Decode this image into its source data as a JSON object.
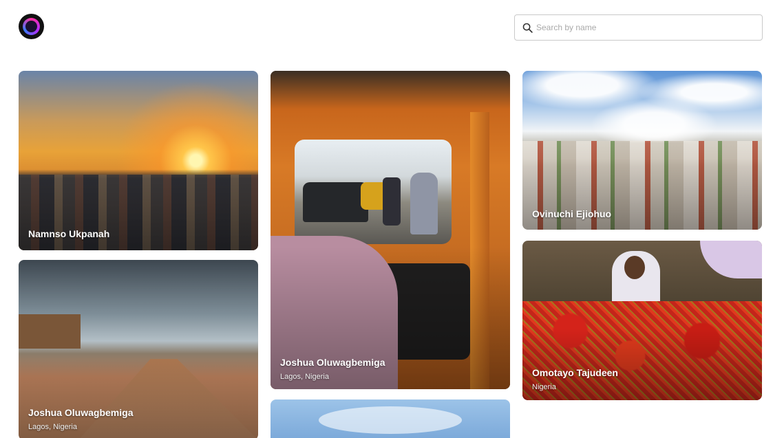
{
  "header": {
    "logo_icon": "logo-icon",
    "search": {
      "placeholder": "Search by name",
      "value": "",
      "icon": "search-icon"
    }
  },
  "cards": [
    {
      "name": "Namnso Ukpanah",
      "location": ""
    },
    {
      "name": "Joshua Oluwagbemiga",
      "location": "Lagos, Nigeria"
    },
    {
      "name": "Ovinuchi Ejiohuo",
      "location": ""
    },
    {
      "name": "Joshua Oluwagbemiga",
      "location": "Lagos, Nigeria"
    },
    {
      "name": "Omotayo Tajudeen",
      "location": "Nigeria"
    },
    {
      "name": "",
      "location": ""
    }
  ]
}
